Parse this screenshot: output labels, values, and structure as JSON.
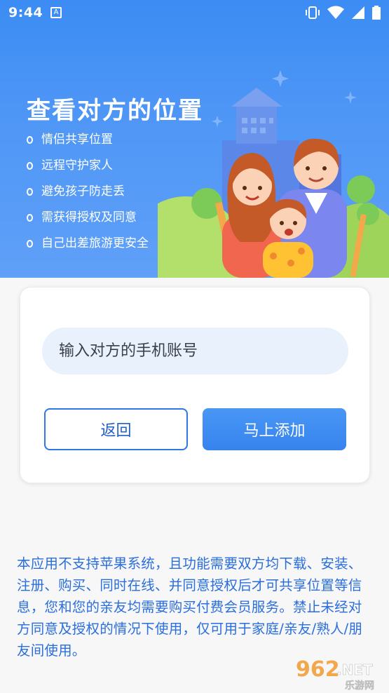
{
  "status_bar": {
    "time": "9:44",
    "a_badge": "A"
  },
  "hero": {
    "title": "查看对方的位置",
    "features": [
      "情侣共享位置",
      "远程守护家人",
      "避免孩子防走丢",
      "需获得授权及同意",
      "自己出差旅游更安全"
    ]
  },
  "form": {
    "placeholder": "输入对方的手机账号",
    "back_label": "返回",
    "add_label": "马上添加"
  },
  "notice": "本应用不支持苹果系统，且功能需要双方均下载、安装、注册、购买、同时在线、并同意授权后才可共享位置等信息，您和您的亲友均需要购买付费会员服务。禁止未经对方同意及授权的情况下使用，仅可用于家庭/亲友/熟人/朋友间使用。",
  "watermark": {
    "number": "962",
    "suffix": ".NET",
    "site": "乐游网"
  },
  "colors": {
    "primary": "#3783ee",
    "hero_bg": "#4e96f6",
    "notice_text": "#2a6edc",
    "input_bg": "#e9f1fd"
  }
}
